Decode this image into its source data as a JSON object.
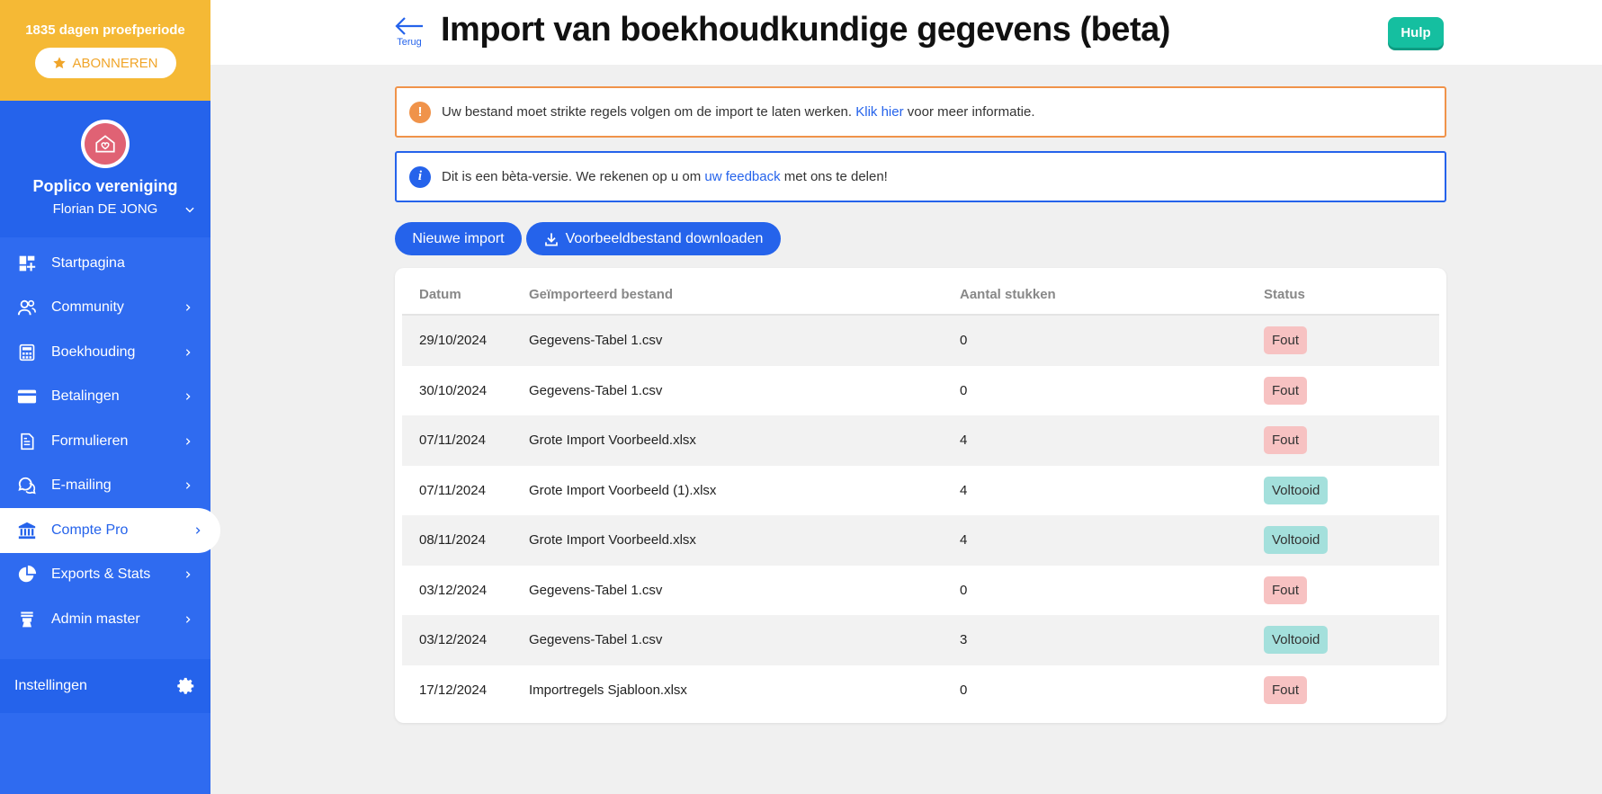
{
  "sidebar": {
    "trial_text": "1835 dagen proefperiode",
    "subscribe_label": "ABONNEREN",
    "org_name": "Poplico vereniging",
    "user_name": "Florian DE JONG",
    "items": [
      {
        "label": "Startpagina",
        "icon": "dashboard-icon"
      },
      {
        "label": "Community",
        "icon": "users-icon"
      },
      {
        "label": "Boekhouding",
        "icon": "calculator-icon"
      },
      {
        "label": "Betalingen",
        "icon": "credit-card-icon"
      },
      {
        "label": "Formulieren",
        "icon": "document-icon"
      },
      {
        "label": "E-mailing",
        "icon": "chat-icon"
      },
      {
        "label": "Compte Pro",
        "icon": "bank-icon"
      },
      {
        "label": "Exports & Stats",
        "icon": "pie-chart-icon"
      },
      {
        "label": "Admin master",
        "icon": "admin-icon"
      }
    ],
    "settings_label": "Instellingen"
  },
  "header": {
    "back_label": "Terug",
    "title": "Import van boekhoudkundige gegevens (beta)",
    "help_label": "Hulp"
  },
  "alerts": {
    "warning": {
      "text_before": "Uw bestand moet strikte regels volgen om de import te laten werken.",
      "link": "Klik hier",
      "text_after": "voor meer informatie."
    },
    "info": {
      "text_before": "Dit is een bèta-versie. We rekenen op u om",
      "link": "uw feedback",
      "text_after": "met ons te delen!"
    }
  },
  "actions": {
    "new_import": "Nieuwe import",
    "download_example": "Voorbeeldbestand downloaden"
  },
  "table": {
    "headers": [
      "Datum",
      "Geïmporteerd bestand",
      "Aantal stukken",
      "Status"
    ],
    "rows": [
      {
        "date": "29/10/2024",
        "file": "Gegevens-Tabel 1.csv",
        "count": "0",
        "status": "Fout"
      },
      {
        "date": "30/10/2024",
        "file": "Gegevens-Tabel 1.csv",
        "count": "0",
        "status": "Fout"
      },
      {
        "date": "07/11/2024",
        "file": "Grote Import Voorbeeld.xlsx",
        "count": "4",
        "status": "Fout"
      },
      {
        "date": "07/11/2024",
        "file": "Grote Import Voorbeeld (1).xlsx",
        "count": "4",
        "status": "Voltooid"
      },
      {
        "date": "08/11/2024",
        "file": "Grote Import Voorbeeld.xlsx",
        "count": "4",
        "status": "Voltooid"
      },
      {
        "date": "03/12/2024",
        "file": "Gegevens-Tabel 1.csv",
        "count": "0",
        "status": "Fout"
      },
      {
        "date": "03/12/2024",
        "file": "Gegevens-Tabel 1.csv",
        "count": "3",
        "status": "Voltooid"
      },
      {
        "date": "17/12/2024",
        "file": "Importregels Sjabloon.xlsx",
        "count": "0",
        "status": "Fout"
      }
    ]
  },
  "colors": {
    "primary": "#2563eb",
    "trial": "#f5b935",
    "help": "#15bfa0",
    "error_badge": "#f7c2c2",
    "success_badge": "#a4e0dc",
    "warning": "#f0934a"
  }
}
